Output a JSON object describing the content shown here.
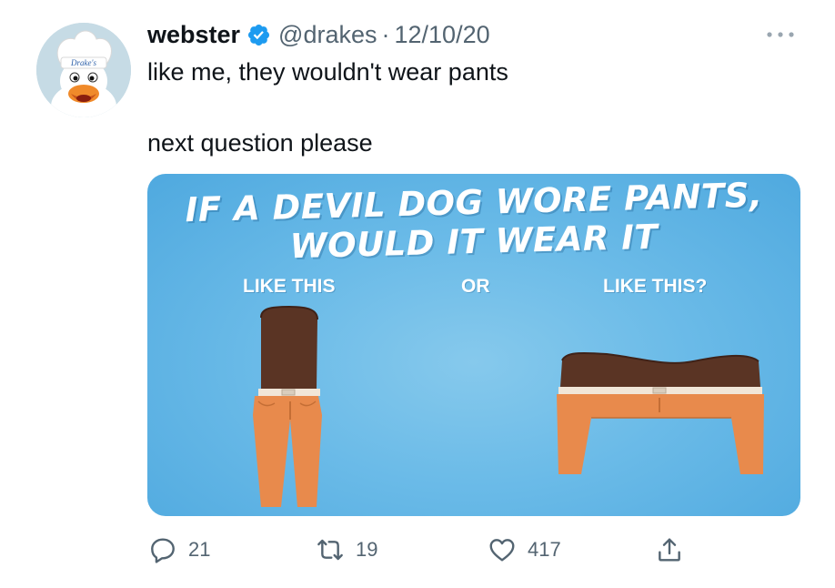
{
  "tweet": {
    "author_name": "webster",
    "handle": "@drakes",
    "separator": "·",
    "date": "12/10/20",
    "line1": "like me, they wouldn't wear pants",
    "line2": "next question please",
    "avatar_hat_text": "Drake's"
  },
  "media": {
    "title_line1": "IF A DEVIL DOG WORE PANTS,",
    "title_line2": "WOULD IT WEAR IT",
    "label_left": "LIKE THIS",
    "label_middle": "OR",
    "label_right": "LIKE THIS?"
  },
  "actions": {
    "reply_count": "21",
    "retweet_count": "19",
    "like_count": "417"
  },
  "colors": {
    "verified": "#1d9bf0",
    "muted": "#536471",
    "media_bg": "#6bbbe8",
    "pants": "#e88a4c",
    "cake": "#5a3424"
  }
}
